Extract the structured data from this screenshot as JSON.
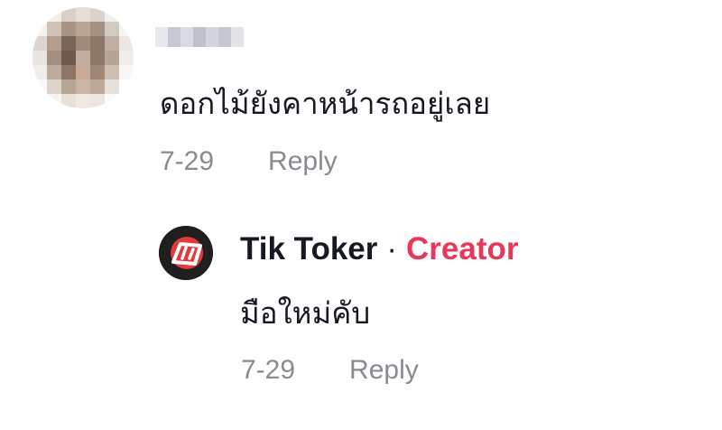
{
  "comment": {
    "text": "ดอกไม้ยังคาหน้ารถอยู่เลย",
    "date": "7-29",
    "reply_label": "Reply"
  },
  "reply": {
    "author": "Tik Toker",
    "separator": "·",
    "badge": "Creator",
    "text": "มือใหม่คับ",
    "date": "7-29",
    "reply_label": "Reply"
  },
  "colors": {
    "text": "#161823",
    "meta": "#8a8b91",
    "creator_badge": "#e8375a"
  }
}
